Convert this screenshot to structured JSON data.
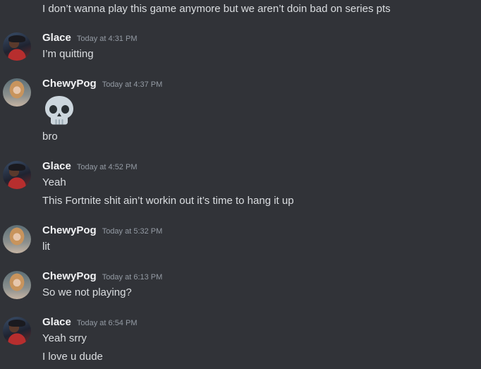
{
  "messages": [
    {
      "type": "continuation",
      "text": "I don’t wanna play this game anymore but we aren’t doin bad on series pts"
    },
    {
      "type": "message",
      "author": "Glace",
      "timestamp": "Today at 4:31 PM",
      "lines": [
        "I’m quitting"
      ]
    },
    {
      "type": "message",
      "author": "ChewyPog",
      "timestamp": "Today at 4:37 PM",
      "emoji": "skull-emoji",
      "lines": [
        "bro"
      ]
    },
    {
      "type": "message",
      "author": "Glace",
      "timestamp": "Today at 4:52 PM",
      "lines": [
        "Yeah",
        "This Fortnite shit ain’t workin out it’s time to hang it up"
      ]
    },
    {
      "type": "message",
      "author": "ChewyPog",
      "timestamp": "Today at 5:32 PM",
      "lines": [
        "lit"
      ]
    },
    {
      "type": "message",
      "author": "ChewyPog",
      "timestamp": "Today at 6:13 PM",
      "lines": [
        "So we not playing?"
      ]
    },
    {
      "type": "message",
      "author": "Glace",
      "timestamp": "Today at 6:54 PM",
      "lines": [
        "Yeah srry",
        "I love u dude"
      ]
    }
  ],
  "colors": {
    "background": "#313338",
    "message_text": "#dbdee1",
    "author_name": "#f2f3f5",
    "timestamp": "#949ba4"
  }
}
